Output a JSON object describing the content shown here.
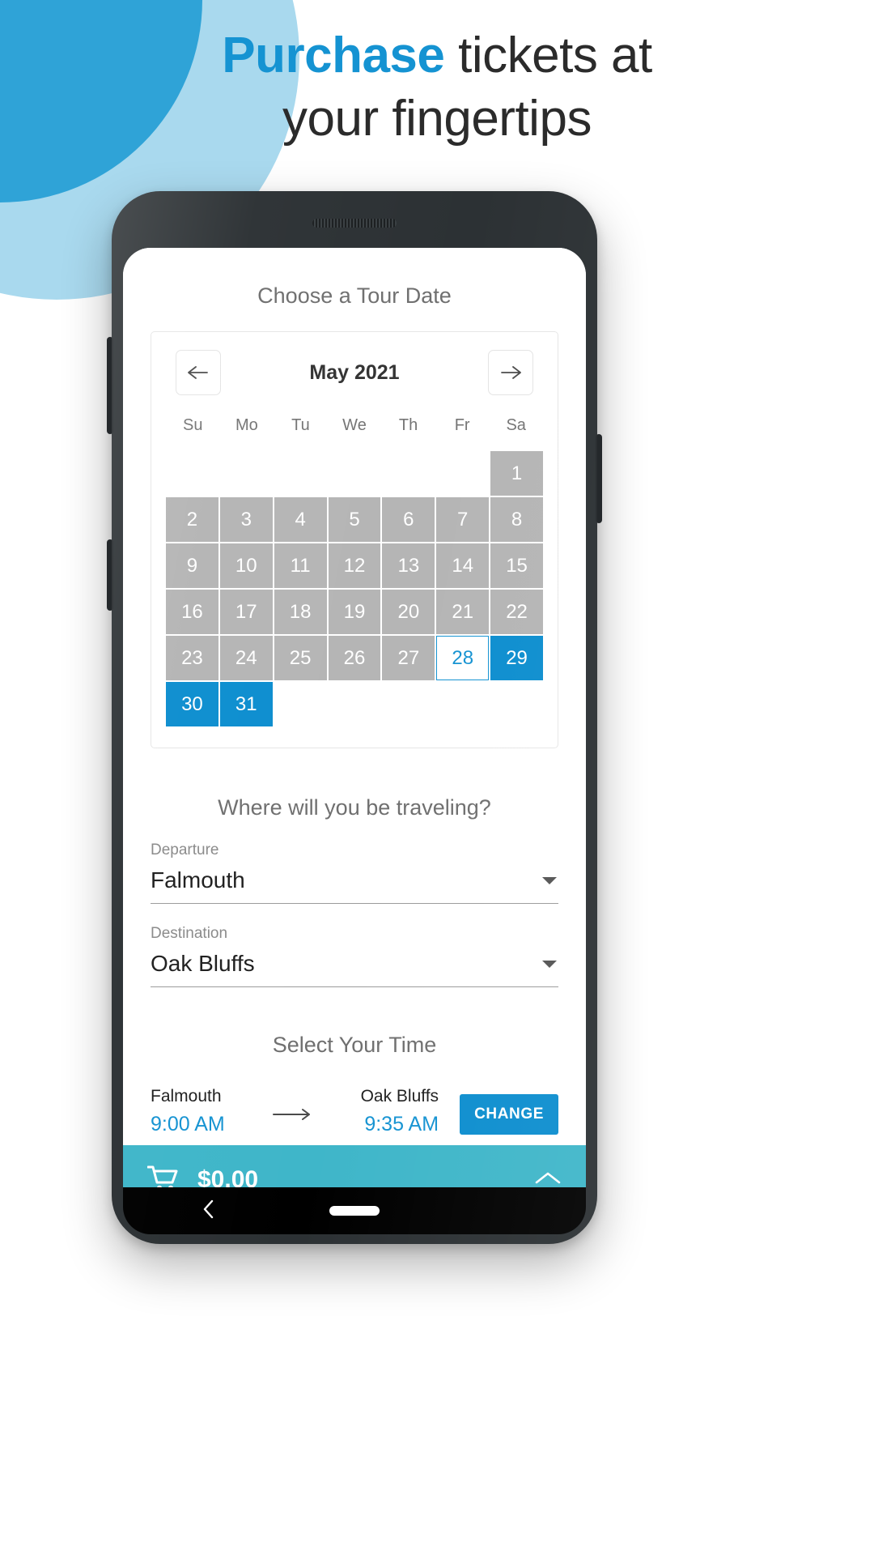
{
  "decor": {
    "arc_outer_color": "#a9d9ee",
    "arc_inner_color": "#2fa3d7"
  },
  "headline": {
    "accent_word": "Purchase",
    "rest_line1": " tickets at",
    "line2": "your fingertips",
    "accent_color": "#1593d2"
  },
  "app": {
    "calendar_section": {
      "title": "Choose a Tour Date",
      "prev_label": "←",
      "next_label": "→",
      "month_label": "May 2021",
      "weekdays": [
        "Su",
        "Mo",
        "Tu",
        "We",
        "Th",
        "Fr",
        "Sa"
      ],
      "leading_blanks": 6,
      "days": [
        {
          "n": "1",
          "state": "disabled"
        },
        {
          "n": "2",
          "state": "disabled"
        },
        {
          "n": "3",
          "state": "disabled"
        },
        {
          "n": "4",
          "state": "disabled"
        },
        {
          "n": "5",
          "state": "disabled"
        },
        {
          "n": "6",
          "state": "disabled"
        },
        {
          "n": "7",
          "state": "disabled"
        },
        {
          "n": "8",
          "state": "disabled"
        },
        {
          "n": "9",
          "state": "disabled"
        },
        {
          "n": "10",
          "state": "disabled"
        },
        {
          "n": "11",
          "state": "disabled"
        },
        {
          "n": "12",
          "state": "disabled"
        },
        {
          "n": "13",
          "state": "disabled"
        },
        {
          "n": "14",
          "state": "disabled"
        },
        {
          "n": "15",
          "state": "disabled"
        },
        {
          "n": "16",
          "state": "disabled"
        },
        {
          "n": "17",
          "state": "disabled"
        },
        {
          "n": "18",
          "state": "disabled"
        },
        {
          "n": "19",
          "state": "disabled"
        },
        {
          "n": "20",
          "state": "disabled"
        },
        {
          "n": "21",
          "state": "disabled"
        },
        {
          "n": "22",
          "state": "disabled"
        },
        {
          "n": "23",
          "state": "disabled"
        },
        {
          "n": "24",
          "state": "disabled"
        },
        {
          "n": "25",
          "state": "disabled"
        },
        {
          "n": "26",
          "state": "disabled"
        },
        {
          "n": "27",
          "state": "disabled"
        },
        {
          "n": "28",
          "state": "today"
        },
        {
          "n": "29",
          "state": "available"
        },
        {
          "n": "30",
          "state": "available"
        },
        {
          "n": "31",
          "state": "available"
        }
      ],
      "colors": {
        "disabled_bg": "#b5b5b5",
        "available_bg": "#0d8ecf",
        "today_text": "#1593d2"
      }
    },
    "travel_section": {
      "title": "Where will you be traveling?",
      "departure_label": "Departure",
      "departure_value": "Falmouth",
      "destination_label": "Destination",
      "destination_value": "Oak Bluffs"
    },
    "time_section": {
      "title": "Select Your Time",
      "from_place": "Falmouth",
      "from_time": "9:00 AM",
      "to_place": "Oak Bluffs",
      "to_time": "9:35 AM",
      "change_label": "CHANGE",
      "time_color": "#1593d2",
      "change_button_color": "#0d8ecf"
    },
    "cart_bar": {
      "total": "$0.00",
      "bar_color": "#3fb6c9"
    }
  }
}
